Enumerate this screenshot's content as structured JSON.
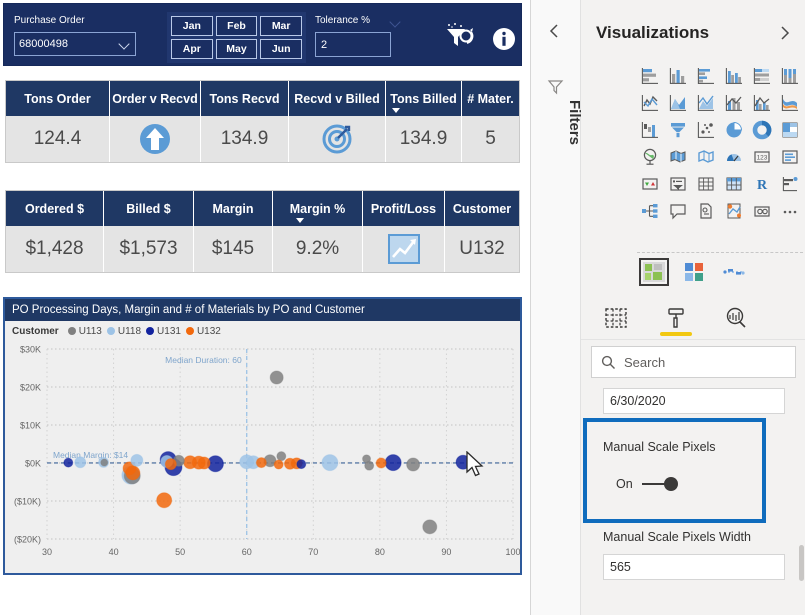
{
  "report": {
    "filter_bar": {
      "po_label": "Purchase Order",
      "po_value": "68000498",
      "months": [
        "Jan",
        "Feb",
        "Mar",
        "Apr",
        "May",
        "Jun"
      ],
      "tolerance_label": "Tolerance %",
      "tolerance_value": "2",
      "clear_filters_icon": "clear-filters-icon",
      "info_icon": "info-icon"
    },
    "kpi_table_1": {
      "headers": [
        "Tons Order",
        "Order v Recvd",
        "Tons Recvd",
        "Recvd v Billed",
        "Tons Billed",
        "# Mater."
      ],
      "values": [
        "124.4",
        "up-arrow-icon",
        "134.9",
        "target-icon",
        "134.9",
        "5"
      ],
      "sorted_column": "Tons Billed"
    },
    "kpi_table_2": {
      "headers": [
        "Ordered $",
        "Billed $",
        "Margin",
        "Margin %",
        "Profit/Loss",
        "Customer"
      ],
      "values": [
        "$1,428",
        "$1,573",
        "$145",
        "9.2%",
        "trend-up-icon",
        "U132"
      ],
      "sorted_column": "Margin %"
    },
    "scatter": {
      "title": "PO Processing Days, Margin and # of Materials by PO and Customer",
      "legend_title": "Customer"
    }
  },
  "chart_data": {
    "type": "scatter",
    "title": "PO Processing Days, Margin and # of Materials by PO and Customer",
    "xlabel": "",
    "ylabel": "",
    "xlim": [
      30,
      100
    ],
    "ylim": [
      -20000,
      30000
    ],
    "xticks": [
      "30",
      "40",
      "50",
      "60",
      "70",
      "80",
      "90",
      "100"
    ],
    "yticks": [
      "$30K",
      "$20K",
      "$10K",
      "$0K",
      "($10K)",
      "($20K)"
    ],
    "ytick_values": [
      30000,
      20000,
      10000,
      0,
      -10000,
      -20000
    ],
    "grid": true,
    "legend_position": "top-left",
    "legend_title": "Customer",
    "series": [
      {
        "name": "U113",
        "color": "#808080"
      },
      {
        "name": "U118",
        "color": "#9DC3E6"
      },
      {
        "name": "U131",
        "color": "#12239E"
      },
      {
        "name": "U132",
        "color": "#F2690D"
      }
    ],
    "reference_lines": [
      {
        "label": "Median Duration: 60",
        "orientation": "vertical",
        "value": 60,
        "color": "#9DC3E6"
      },
      {
        "label": "Median Margin: $14",
        "orientation": "horizontal",
        "value": 14,
        "color": "#5B7BA6"
      }
    ],
    "points": [
      {
        "series": "U131",
        "x": 33.2,
        "y": 100,
        "size": 9
      },
      {
        "series": "U118",
        "x": 35.0,
        "y": 200,
        "size": 11
      },
      {
        "series": "U118",
        "x": 38.5,
        "y": 150,
        "size": 10
      },
      {
        "series": "U113",
        "x": 38.6,
        "y": 120,
        "size": 7
      },
      {
        "series": "U118",
        "x": 42.6,
        "y": -3200,
        "size": 18
      },
      {
        "series": "U113",
        "x": 42.8,
        "y": -3400,
        "size": 16
      },
      {
        "series": "U132",
        "x": 42.4,
        "y": -1400,
        "size": 13
      },
      {
        "series": "U132",
        "x": 42.9,
        "y": -2600,
        "size": 14
      },
      {
        "series": "U118",
        "x": 43.5,
        "y": 700,
        "size": 12
      },
      {
        "series": "U132",
        "x": 47.6,
        "y": -9800,
        "size": 15
      },
      {
        "series": "U131",
        "x": 48.2,
        "y": 900,
        "size": 16
      },
      {
        "series": "U131",
        "x": 49.0,
        "y": -1100,
        "size": 17
      },
      {
        "series": "U118",
        "x": 48.0,
        "y": 400,
        "size": 12
      },
      {
        "series": "U113",
        "x": 49.8,
        "y": 600,
        "size": 11
      },
      {
        "series": "U132",
        "x": 48.6,
        "y": -300,
        "size": 11
      },
      {
        "series": "U132",
        "x": 51.5,
        "y": 200,
        "size": 13
      },
      {
        "series": "U132",
        "x": 52.8,
        "y": 100,
        "size": 13
      },
      {
        "series": "U132",
        "x": 53.6,
        "y": 0,
        "size": 12
      },
      {
        "series": "U131",
        "x": 55.3,
        "y": -200,
        "size": 16
      },
      {
        "series": "U118",
        "x": 60.0,
        "y": 300,
        "size": 14
      },
      {
        "series": "U118",
        "x": 61.0,
        "y": 200,
        "size": 13
      },
      {
        "series": "U132",
        "x": 62.2,
        "y": 100,
        "size": 10
      },
      {
        "series": "U113",
        "x": 63.5,
        "y": 600,
        "size": 12
      },
      {
        "series": "U113",
        "x": 64.5,
        "y": 22500,
        "size": 13
      },
      {
        "series": "U113",
        "x": 65.2,
        "y": 1800,
        "size": 9
      },
      {
        "series": "U132",
        "x": 64.8,
        "y": -400,
        "size": 9
      },
      {
        "series": "U132",
        "x": 66.5,
        "y": -200,
        "size": 11
      },
      {
        "series": "U132",
        "x": 67.5,
        "y": -100,
        "size": 11
      },
      {
        "series": "U131",
        "x": 68.2,
        "y": -300,
        "size": 9
      },
      {
        "series": "U118",
        "x": 72.5,
        "y": 100,
        "size": 16
      },
      {
        "series": "U113",
        "x": 78.0,
        "y": 1100,
        "size": 8
      },
      {
        "series": "U113",
        "x": 78.4,
        "y": -700,
        "size": 9
      },
      {
        "series": "U132",
        "x": 80.2,
        "y": 0,
        "size": 10
      },
      {
        "series": "U131",
        "x": 82.0,
        "y": 100,
        "size": 16
      },
      {
        "series": "U113",
        "x": 85.0,
        "y": -400,
        "size": 13
      },
      {
        "series": "U113",
        "x": 87.5,
        "y": -16800,
        "size": 14
      },
      {
        "series": "U131",
        "x": 92.5,
        "y": 200,
        "size": 14
      }
    ]
  },
  "right_pane": {
    "filters_label": "Filters",
    "collapse_icon": "chevron-left-icon",
    "filters_icon": "filter-funnel-icon",
    "visualizations_title": "Visualizations",
    "expand_icon": "chevron-right-icon",
    "viz_icons": [
      "stacked-bar-chart-icon",
      "stacked-column-chart-icon",
      "clustered-bar-chart-icon",
      "clustered-column-chart-icon",
      "100-stacked-bar-chart-icon",
      "100-stacked-column-chart-icon",
      "line-chart-icon",
      "area-chart-icon",
      "stacked-area-chart-icon",
      "line-stacked-column-chart-icon",
      "line-clustered-column-chart-icon",
      "ribbon-chart-icon",
      "waterfall-chart-icon",
      "funnel-chart-icon",
      "scatter-chart-icon",
      "pie-chart-icon",
      "donut-chart-icon",
      "treemap-icon",
      "map-icon",
      "filled-map-icon",
      "shape-map-icon",
      "gauge-icon",
      "card-icon",
      "multi-row-card-icon",
      "kpi-icon",
      "slicer-icon",
      "table-icon",
      "matrix-icon",
      "r-script-visual-icon",
      "key-influencers-icon",
      "decomposition-tree-icon",
      "q-and-a-icon",
      "smart-narrative-icon",
      "paginated-report-icon",
      "power-apps-icon",
      "more-options-icon"
    ],
    "custom_visuals": [
      "custom-visual-selected-icon",
      "custom-visual-squares-icon",
      "custom-visual-network-icon"
    ],
    "pane_tabs": [
      "fields-pane-tab",
      "format-pane-tab",
      "analytics-pane-tab"
    ],
    "active_pane_tab": "format-pane-tab",
    "search_placeholder": "Search",
    "search_icon": "search-icon",
    "date_value": "6/30/2020",
    "manual_scale_label": "Manual Scale Pixels",
    "manual_scale_state": "On",
    "manual_width_label": "Manual Scale Pixels Width",
    "manual_width_value": "565",
    "highlight_color": "#0f6cbd"
  }
}
